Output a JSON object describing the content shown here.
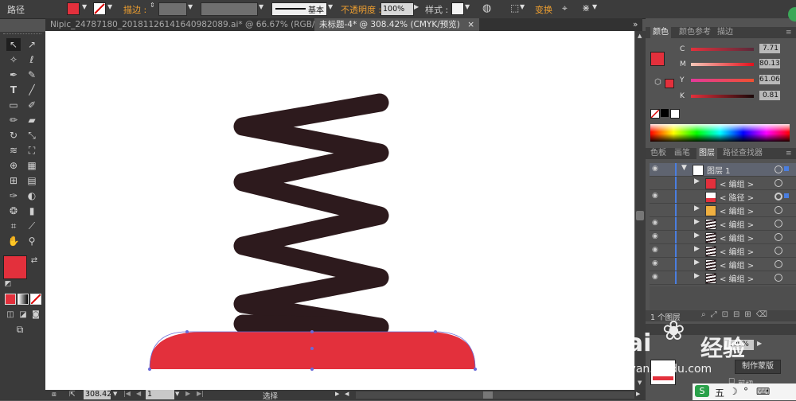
{
  "toolbar": {
    "object_label": "路径",
    "stroke_label": "描边 :",
    "stroke_style": "基本",
    "opacity_label": "不透明度 :",
    "opacity_value": "100%",
    "style_label": "样式 :",
    "transform_label": "变换"
  },
  "tabs": [
    {
      "label": "Nipic_24787180_20181126141640982089.ai* @ 66.67% (RGB/预览)",
      "active": false
    },
    {
      "label": "未标题-4* @ 308.42% (CMYK/预览)",
      "active": true
    }
  ],
  "color_panel": {
    "tabs": [
      "颜色",
      "颜色参考",
      "描边"
    ],
    "channels": [
      {
        "name": "C",
        "value": "7.71"
      },
      {
        "name": "M",
        "value": "80.13"
      },
      {
        "name": "Y",
        "value": "61.06"
      },
      {
        "name": "K",
        "value": "0.81"
      }
    ]
  },
  "layers_panel": {
    "tabs": [
      "色板",
      "画笔",
      "图层",
      "路径查找器"
    ],
    "rows": [
      {
        "label": "图层 1",
        "level": 0
      },
      {
        "label": "< 编组 >",
        "level": 1
      },
      {
        "label": "< 路径 >",
        "level": 1
      },
      {
        "label": "< 编组 >",
        "level": 1
      },
      {
        "label": "< 编组 >",
        "level": 1
      },
      {
        "label": "< 编组 >",
        "level": 1
      },
      {
        "label": "< 编组 >",
        "level": 1
      },
      {
        "label": "< 编组 >",
        "level": 1
      },
      {
        "label": "< 编组 >",
        "level": 1
      }
    ],
    "footer": "1 个图层",
    "mask_button": "制作蒙版",
    "clip_label": "剪切"
  },
  "transparency_panel": {
    "opacity_value": "100%"
  },
  "status": {
    "zoom": "308.42",
    "page": "1",
    "mode": "选择"
  },
  "watermark": {
    "brand": "Bai",
    "brand2": "经验",
    "url": "jingyan.baidu.com"
  },
  "colors": {
    "fill": "#e3303c",
    "spring": "#2d1a1d",
    "accent_orange": "#f0a030"
  }
}
